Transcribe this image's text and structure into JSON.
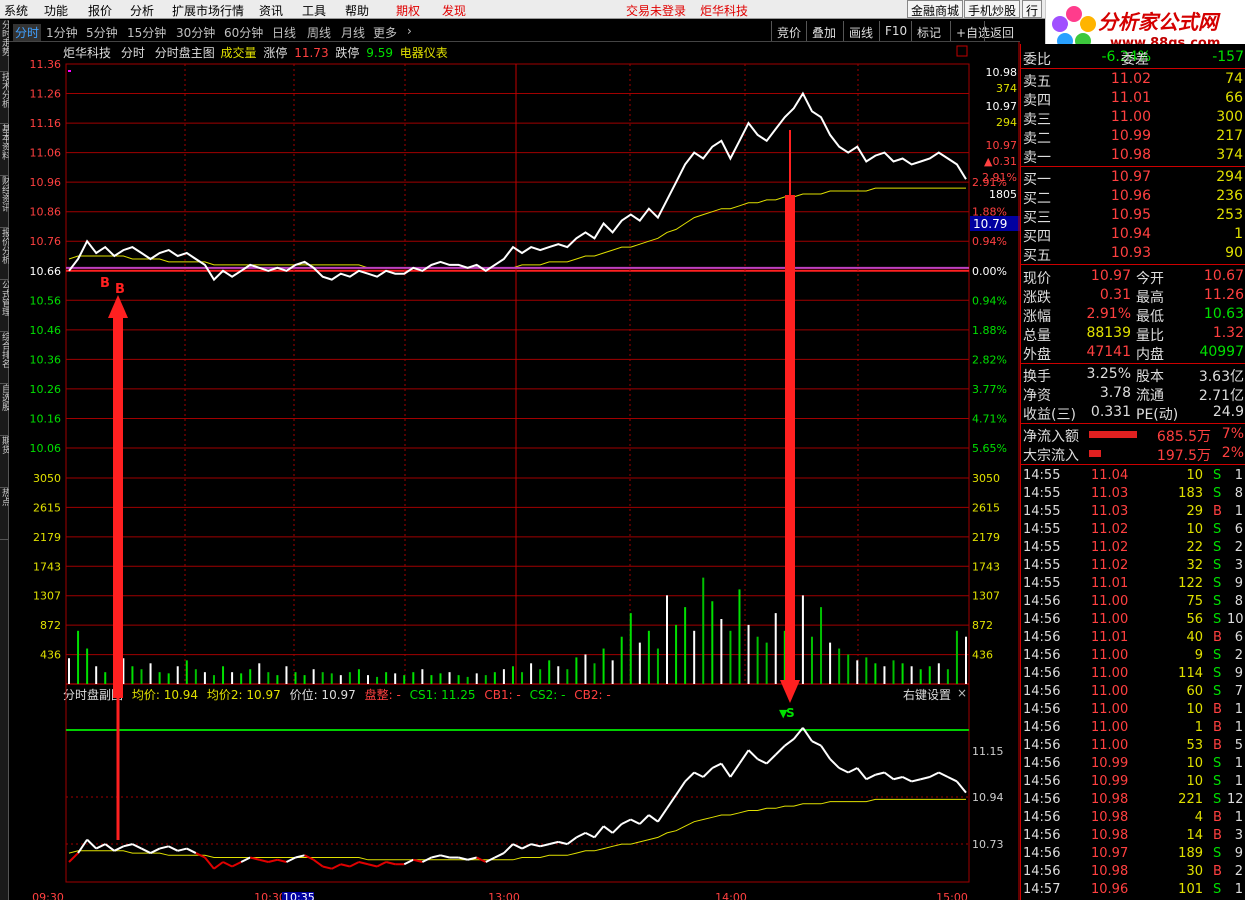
{
  "menu": {
    "items": [
      "系统",
      "功能",
      "报价",
      "分析",
      "扩展市场行情",
      "资讯",
      "工具",
      "帮助"
    ],
    "red_items": [
      "期权",
      "发现"
    ],
    "login_status": "交易未登录",
    "stock_title": "炬华科技",
    "right_buttons": [
      "金融商城",
      "手机炒股"
    ],
    "right_partial": "行"
  },
  "logo": {
    "title": "分析家公式网",
    "url": "www.88gs.com"
  },
  "left_tabs": [
    "分时走势",
    "技术分析",
    "基本资料",
    "财经资讯",
    "报价分析",
    "公式管理",
    "综合排名",
    "自选股",
    "期货",
    "热点"
  ],
  "periods": [
    "分时",
    "1分钟",
    "5分钟",
    "15分钟",
    "30分钟",
    "60分钟",
    "日线",
    "周线",
    "月线",
    "更多"
  ],
  "active_period": "分时",
  "toolbar": [
    "竞价",
    "叠加",
    "画线",
    "F10",
    "标记",
    "+自选",
    "返回"
  ],
  "main_info": {
    "name": "炬华科技",
    "mode": "分时",
    "chart_name": "分时盘主图",
    "volume_label": "成交量",
    "limit_up_label": "涨停",
    "limit_up_value": "11.73",
    "limit_down_label": "跌停",
    "limit_down_value": "9.59",
    "gauge_label": "电器仪表"
  },
  "sub_info": {
    "title": "分时盘副图",
    "avg1": "均价: 10.94",
    "avg2": "均价2: 10.97",
    "price": "价位: 10.97",
    "trend": "盘整: -",
    "cs1": "CS1: 11.25",
    "cb1": "CB1: -",
    "cs2": "CS2: -",
    "cb2": "CB2: -",
    "settings": "右键设置",
    "close": "×"
  },
  "price_axis_left": [
    "11.36",
    "11.26",
    "11.16",
    "11.06",
    "10.96",
    "10.86",
    "10.76",
    "10.66",
    "10.56",
    "10.46",
    "10.36",
    "10.26",
    "10.16",
    "10.06"
  ],
  "pct_axis_right": [
    "",
    "",
    "",
    "",
    "2.91%",
    "1.88%",
    "0.94%",
    "0.00%",
    "0.94%",
    "1.88%",
    "2.82%",
    "3.77%",
    "4.71%",
    "5.65%"
  ],
  "volume_axis": [
    "3050",
    "2615",
    "2179",
    "1743",
    "1307",
    "872",
    "436"
  ],
  "right_scale_extra": {
    "price_hi": "10.98",
    "vol_hi": "374",
    "price_2": "10.97",
    "vol_2": "294",
    "price_cur": "10.97",
    "change": "▲0.31",
    "pct": "2.91%",
    "vol_cur": "1805",
    "cursor_price": "10.79"
  },
  "sub_axis": [
    "11.15",
    "10.94",
    "10.73"
  ],
  "time_axis": [
    "09:30",
    "10:30",
    "10:35",
    "13:00",
    "14:00",
    "15:00"
  ],
  "markers": {
    "buy1": "B",
    "buy2": "B",
    "sell": "S",
    "sell_tri": "▼"
  },
  "order_book": {
    "header": {
      "label": "委比",
      "value": "-6.24%",
      "label2": "委差",
      "value2": "-157"
    },
    "asks": [
      {
        "label": "卖五",
        "price": "11.02",
        "vol": "74"
      },
      {
        "label": "卖四",
        "price": "11.01",
        "vol": "66"
      },
      {
        "label": "卖三",
        "price": "11.00",
        "vol": "300"
      },
      {
        "label": "卖二",
        "price": "10.99",
        "vol": "217"
      },
      {
        "label": "卖一",
        "price": "10.98",
        "vol": "374"
      }
    ],
    "bids": [
      {
        "label": "买一",
        "price": "10.97",
        "vol": "294"
      },
      {
        "label": "买二",
        "price": "10.96",
        "vol": "236"
      },
      {
        "label": "买三",
        "price": "10.95",
        "vol": "253"
      },
      {
        "label": "买四",
        "price": "10.94",
        "vol": "1"
      },
      {
        "label": "买五",
        "price": "10.93",
        "vol": "90"
      }
    ]
  },
  "quote_stats": [
    {
      "l1": "现价",
      "v1": "10.97",
      "l2": "今开",
      "v2": "10.67",
      "c1": "#ff4040",
      "c2": "#ff4040"
    },
    {
      "l1": "涨跌",
      "v1": "0.31",
      "l2": "最高",
      "v2": "11.26",
      "c1": "#ff4040",
      "c2": "#ff4040"
    },
    {
      "l1": "涨幅",
      "v1": "2.91%",
      "l2": "最低",
      "v2": "10.63",
      "c1": "#ff4040",
      "c2": "#00e000"
    },
    {
      "l1": "总量",
      "v1": "88139",
      "l2": "量比",
      "v2": "1.32",
      "c1": "#e0e000",
      "c2": "#ff4040"
    },
    {
      "l1": "外盘",
      "v1": "47141",
      "l2": "内盘",
      "v2": "40997",
      "c1": "#ff4040",
      "c2": "#00e000"
    }
  ],
  "fund_stats": [
    {
      "l1": "换手",
      "v1": "3.25%",
      "l2": "股本",
      "v2": "3.63亿"
    },
    {
      "l1": "净资",
      "v1": "3.78",
      "l2": "流通",
      "v2": "2.71亿"
    },
    {
      "l1": "收益(三)",
      "v1": "0.331",
      "l2": "PE(动)",
      "v2": "24.9"
    }
  ],
  "flows": [
    {
      "label": "净流入额",
      "value": "685.5万",
      "pct": "7%",
      "bar": 0.8
    },
    {
      "label": "大宗流入",
      "value": "197.5万",
      "pct": "2%",
      "bar": 0.2
    }
  ],
  "trades": [
    {
      "t": "14:55",
      "p": "11.04",
      "v": "10",
      "s": "S",
      "n": "1"
    },
    {
      "t": "14:55",
      "p": "11.03",
      "v": "183",
      "s": "S",
      "n": "8"
    },
    {
      "t": "14:55",
      "p": "11.03",
      "v": "29",
      "s": "B",
      "n": "1"
    },
    {
      "t": "14:55",
      "p": "11.02",
      "v": "10",
      "s": "S",
      "n": "6"
    },
    {
      "t": "14:55",
      "p": "11.02",
      "v": "22",
      "s": "S",
      "n": "2"
    },
    {
      "t": "14:55",
      "p": "11.02",
      "v": "32",
      "s": "S",
      "n": "3"
    },
    {
      "t": "14:55",
      "p": "11.01",
      "v": "122",
      "s": "S",
      "n": "9"
    },
    {
      "t": "14:56",
      "p": "11.00",
      "v": "75",
      "s": "S",
      "n": "8"
    },
    {
      "t": "14:56",
      "p": "11.00",
      "v": "56",
      "s": "S",
      "n": "10"
    },
    {
      "t": "14:56",
      "p": "11.01",
      "v": "40",
      "s": "B",
      "n": "6"
    },
    {
      "t": "14:56",
      "p": "11.00",
      "v": "9",
      "s": "S",
      "n": "2"
    },
    {
      "t": "14:56",
      "p": "11.00",
      "v": "114",
      "s": "S",
      "n": "9"
    },
    {
      "t": "14:56",
      "p": "11.00",
      "v": "60",
      "s": "S",
      "n": "7"
    },
    {
      "t": "14:56",
      "p": "11.00",
      "v": "10",
      "s": "B",
      "n": "1"
    },
    {
      "t": "14:56",
      "p": "11.00",
      "v": "1",
      "s": "B",
      "n": "1"
    },
    {
      "t": "14:56",
      "p": "11.00",
      "v": "53",
      "s": "B",
      "n": "5"
    },
    {
      "t": "14:56",
      "p": "10.99",
      "v": "10",
      "s": "S",
      "n": "1"
    },
    {
      "t": "14:56",
      "p": "10.99",
      "v": "10",
      "s": "S",
      "n": "1"
    },
    {
      "t": "14:56",
      "p": "10.98",
      "v": "221",
      "s": "S",
      "n": "12"
    },
    {
      "t": "14:56",
      "p": "10.98",
      "v": "4",
      "s": "B",
      "n": "1"
    },
    {
      "t": "14:56",
      "p": "10.98",
      "v": "14",
      "s": "B",
      "n": "3"
    },
    {
      "t": "14:56",
      "p": "10.97",
      "v": "189",
      "s": "S",
      "n": "9"
    },
    {
      "t": "14:56",
      "p": "10.98",
      "v": "30",
      "s": "B",
      "n": "2"
    },
    {
      "t": "14:57",
      "p": "10.96",
      "v": "101",
      "s": "S",
      "n": "1"
    }
  ],
  "colors": {
    "up": "#ff4040",
    "down": "#00e000",
    "grid": "#a00000",
    "price_line": "#ffffff",
    "avg_line": "#e0e000",
    "ref_line": "#c040c0",
    "cs_line": "#00d000"
  },
  "chart_data": {
    "type": "line",
    "title": "分时盘主图",
    "price_range": [
      10.06,
      11.36
    ],
    "prev_close": 10.66,
    "price_series": [
      10.66,
      10.7,
      10.76,
      10.72,
      10.74,
      10.71,
      10.73,
      10.74,
      10.72,
      10.7,
      10.72,
      10.73,
      10.71,
      10.72,
      10.7,
      10.68,
      10.63,
      10.66,
      10.64,
      10.66,
      10.68,
      10.67,
      10.66,
      10.67,
      10.66,
      10.68,
      10.69,
      10.67,
      10.64,
      10.63,
      10.65,
      10.64,
      10.66,
      10.65,
      10.64,
      10.66,
      10.65,
      10.65,
      10.67,
      10.66,
      10.68,
      10.69,
      10.68,
      10.68,
      10.67,
      10.68,
      10.66,
      10.68,
      10.7,
      10.74,
      10.72,
      10.74,
      10.73,
      10.74,
      10.75,
      10.74,
      10.77,
      10.79,
      10.77,
      10.82,
      10.79,
      10.83,
      10.85,
      10.83,
      10.87,
      10.84,
      10.9,
      10.96,
      11.02,
      11.06,
      11.04,
      11.08,
      11.1,
      11.04,
      11.1,
      11.16,
      11.12,
      11.1,
      11.14,
      11.18,
      11.21,
      11.26,
      11.2,
      11.18,
      11.12,
      11.08,
      11.06,
      11.08,
      11.03,
      11.05,
      11.06,
      11.03,
      11.04,
      11.02,
      11.03,
      11.04,
      11.06,
      11.04,
      11.02,
      10.97
    ],
    "avg_series": [
      10.7,
      10.71,
      10.71,
      10.71,
      10.71,
      10.71,
      10.71,
      10.7,
      10.7,
      10.7,
      10.7,
      10.69,
      10.69,
      10.69,
      10.69,
      10.69,
      10.68,
      10.68,
      10.68,
      10.68,
      10.68,
      10.68,
      10.68,
      10.68,
      10.68,
      10.68,
      10.68,
      10.68,
      10.68,
      10.68,
      10.68,
      10.68,
      10.68,
      10.67,
      10.67,
      10.67,
      10.67,
      10.67,
      10.67,
      10.67,
      10.67,
      10.67,
      10.67,
      10.67,
      10.67,
      10.67,
      10.67,
      10.67,
      10.67,
      10.67,
      10.68,
      10.68,
      10.68,
      10.69,
      10.69,
      10.69,
      10.7,
      10.71,
      10.71,
      10.72,
      10.73,
      10.74,
      10.74,
      10.75,
      10.76,
      10.77,
      10.79,
      10.8,
      10.82,
      10.84,
      10.85,
      10.86,
      10.87,
      10.87,
      10.88,
      10.89,
      10.89,
      10.9,
      10.9,
      10.91,
      10.91,
      10.92,
      10.92,
      10.92,
      10.93,
      10.93,
      10.93,
      10.93,
      10.93,
      10.94,
      10.94,
      10.94,
      10.94,
      10.94,
      10.94,
      10.94,
      10.94,
      10.94,
      10.94,
      10.94
    ],
    "volume_range": [
      0,
      3485
    ],
    "volume_series": [
      436,
      900,
      600,
      300,
      200,
      150,
      436,
      300,
      250,
      350,
      200,
      180,
      300,
      400,
      250,
      200,
      150,
      300,
      200,
      180,
      250,
      350,
      200,
      150,
      300,
      200,
      150,
      250,
      200,
      180,
      150,
      200,
      250,
      150,
      120,
      200,
      180,
      150,
      200,
      250,
      150,
      180,
      200,
      150,
      120,
      180,
      150,
      200,
      250,
      300,
      200,
      350,
      250,
      400,
      300,
      250,
      450,
      500,
      350,
      600,
      400,
      800,
      1200,
      700,
      900,
      600,
      1500,
      1000,
      1300,
      900,
      1800,
      1400,
      1100,
      900,
      1600,
      1000,
      800,
      700,
      1200,
      900,
      1000,
      1500,
      800,
      1300,
      700,
      600,
      500,
      400,
      450,
      350,
      300,
      400,
      350,
      300,
      250,
      300,
      350,
      250,
      900,
      800
    ]
  }
}
